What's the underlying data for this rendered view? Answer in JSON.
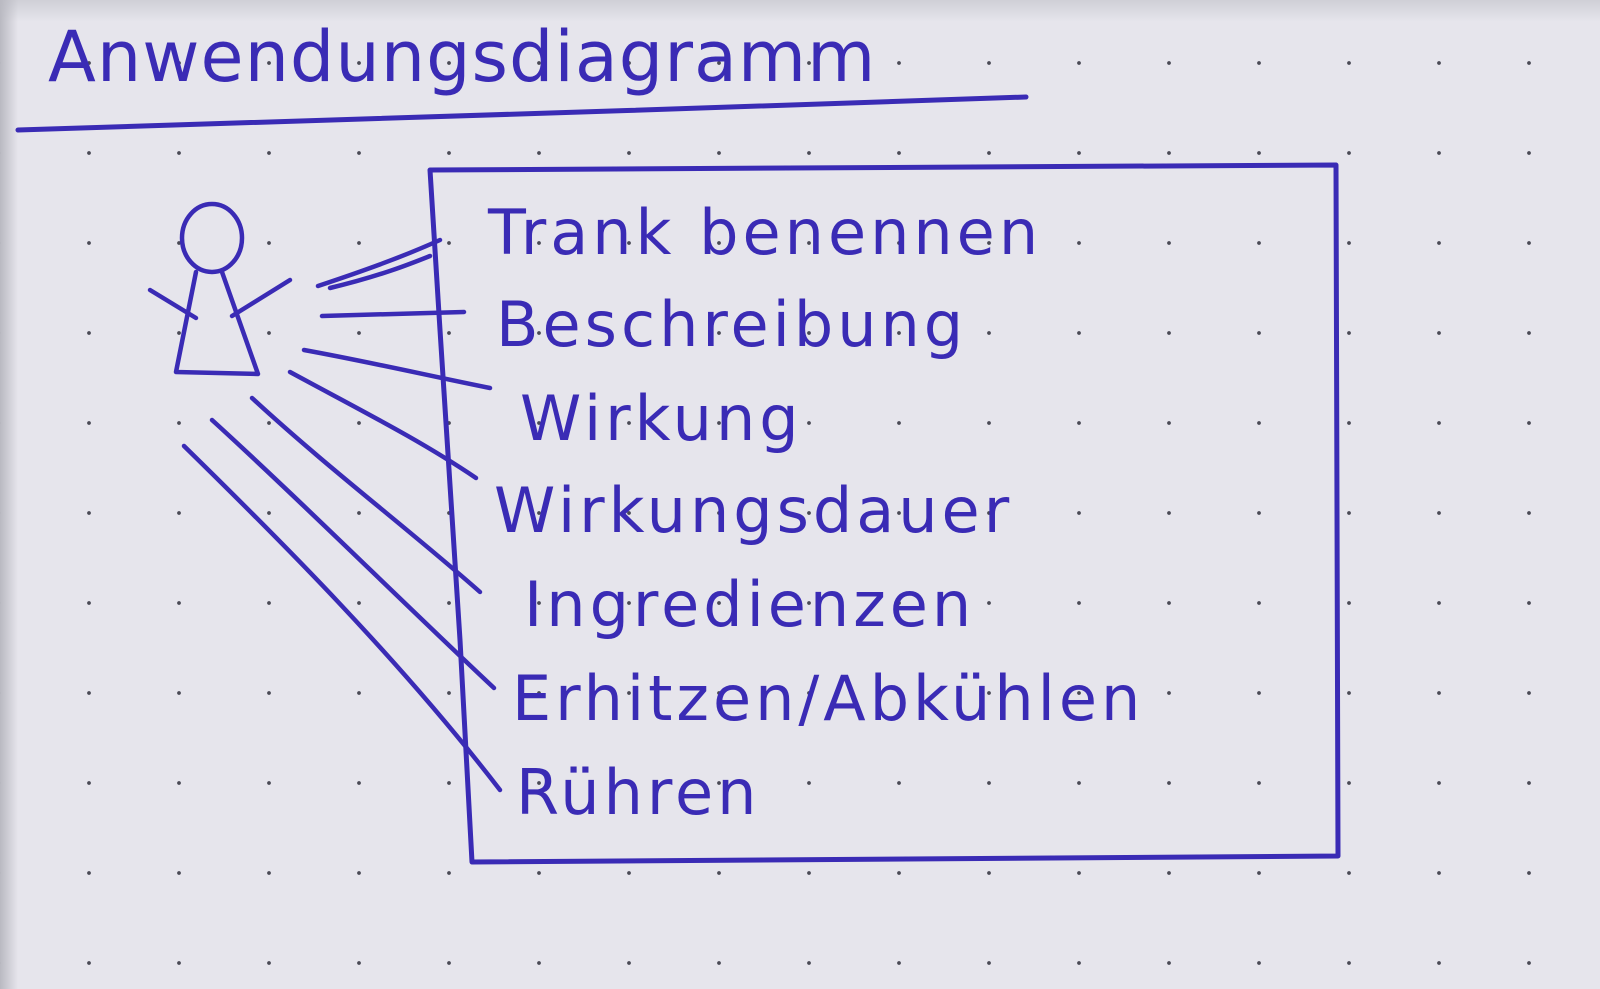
{
  "title": "Anwendungsdiagramm",
  "ink_color": "#3a2bb5",
  "paper_color": "#e6e5ec",
  "actor": {
    "icon": "stick-figure-actor-icon"
  },
  "use_cases": [
    {
      "label": "Trank benennen"
    },
    {
      "label": "Beschreibung"
    },
    {
      "label": "Wirkung"
    },
    {
      "label": "Wirkungsdauer"
    },
    {
      "label": "Ingredienzen"
    },
    {
      "label": "Erhitzen/Abkühlen"
    },
    {
      "label": "Rühren"
    }
  ]
}
